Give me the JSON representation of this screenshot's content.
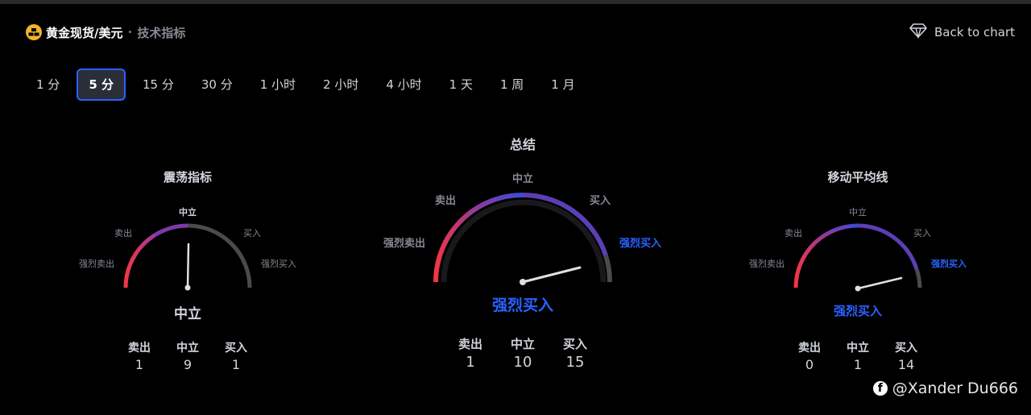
{
  "header": {
    "title": "黄金现货/美元",
    "separator": "•",
    "subtitle": "技术指标",
    "back_label": "Back to chart"
  },
  "tabs": [
    {
      "label": "1 分",
      "active": false
    },
    {
      "label": "5 分",
      "active": true
    },
    {
      "label": "15 分",
      "active": false
    },
    {
      "label": "30 分",
      "active": false
    },
    {
      "label": "1 小时",
      "active": false
    },
    {
      "label": "2 小时",
      "active": false
    },
    {
      "label": "4 小时",
      "active": false
    },
    {
      "label": "1 天",
      "active": false
    },
    {
      "label": "1 周",
      "active": false
    },
    {
      "label": "1 月",
      "active": false
    }
  ],
  "gauges": {
    "oscillators": {
      "title": "震荡指标",
      "labels": {
        "strong_sell": "强烈卖出",
        "sell": "卖出",
        "neutral": "中立",
        "buy": "买入",
        "strong_buy": "强烈买入"
      },
      "result": "中立",
      "counts": [
        {
          "label": "卖出",
          "value": "1"
        },
        {
          "label": "中立",
          "value": "9"
        },
        {
          "label": "买入",
          "value": "1"
        }
      ]
    },
    "summary": {
      "title": "总结",
      "labels": {
        "strong_sell": "强烈卖出",
        "sell": "卖出",
        "neutral": "中立",
        "buy": "买入",
        "strong_buy": "强烈买入"
      },
      "result": "强烈买入",
      "counts": [
        {
          "label": "卖出",
          "value": "1"
        },
        {
          "label": "中立",
          "value": "10"
        },
        {
          "label": "买入",
          "value": "15"
        }
      ]
    },
    "moving_averages": {
      "title": "移动平均线",
      "labels": {
        "strong_sell": "强烈卖出",
        "sell": "卖出",
        "neutral": "中立",
        "buy": "买入",
        "strong_buy": "强烈买入"
      },
      "result": "强烈买入",
      "counts": [
        {
          "label": "卖出",
          "value": "0"
        },
        {
          "label": "中立",
          "value": "1"
        },
        {
          "label": "买入",
          "value": "14"
        }
      ]
    }
  },
  "colors": {
    "strong_buy": "#2962ff",
    "neutral_text": "#d1d4dc",
    "active_tab_border": "#2962ff",
    "sell_red": "#f23645"
  },
  "watermark": "@Xander Du666"
}
